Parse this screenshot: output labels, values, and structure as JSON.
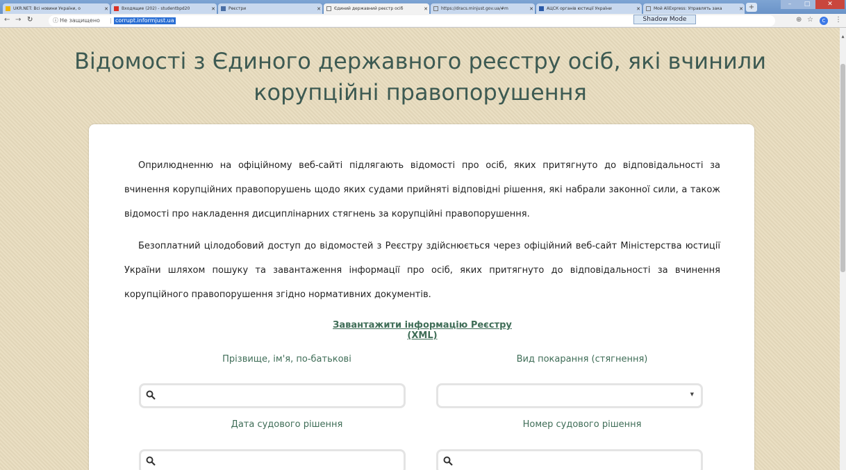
{
  "browser": {
    "tabs": [
      {
        "title": "UKR.NET: Всі новини України, о",
        "icon": "ukrnet-favicon",
        "active": false
      },
      {
        "title": "Входящие (202) - studentbpd20",
        "icon": "gmail-favicon",
        "active": false
      },
      {
        "title": "Реєстри",
        "icon": "registry-favicon",
        "active": false
      },
      {
        "title": "Єдиний державний реєстр осіб",
        "icon": "page-favicon",
        "active": true
      },
      {
        "title": "https://dracs.minjust.gov.ua/#m",
        "icon": "page-favicon",
        "active": false
      },
      {
        "title": "АЦСК органів юстиції України",
        "icon": "acsk-favicon",
        "active": false
      },
      {
        "title": "Мой AliExpress: Управлять зака",
        "icon": "page-favicon",
        "active": false
      }
    ],
    "security_label": "Не защищено",
    "url": "corrupt.informjust.ua",
    "shadow_mode": "Shadow Mode",
    "profile_initial": "C"
  },
  "page": {
    "title": "Відомості з Єдиного державного реєстру осіб, які вчинили корупційні правопорушення",
    "paragraph1": "Оприлюдненню на офіційному веб-сайті підлягають відомості про осіб, яких притягнуто до відповідальності за вчинення корупційних правопорушень щодо яких судами прийняті відповідні рішення, які набрали законної сили, а також відомості про накладення дисциплінарних стягнень за корупційні правопорушення.",
    "paragraph2": "Безоплатний цілодобовий доступ до відомостей з Реєстру здійснюється через офіційний веб-сайт Міністерства юстиції України шляхом пошуку та завантаження інформації про осіб, яких притягнуто до відповідальності за вчинення корупційного правопорушення згідно нормативних документів.",
    "download_link": "Завантажити інформацію Реєстру (XML)",
    "fields": {
      "name_label": "Прізвище, ім'я, по-батькові",
      "punishment_label": "Вид покарання (стягнення)",
      "date_label": "Дата судового рішення",
      "number_label": "Номер судового рішення"
    }
  },
  "colors": {
    "title": "#3d5a52",
    "label": "#3f6d57",
    "background": "#e8dcbe",
    "url_highlight": "#2b6fd4"
  }
}
